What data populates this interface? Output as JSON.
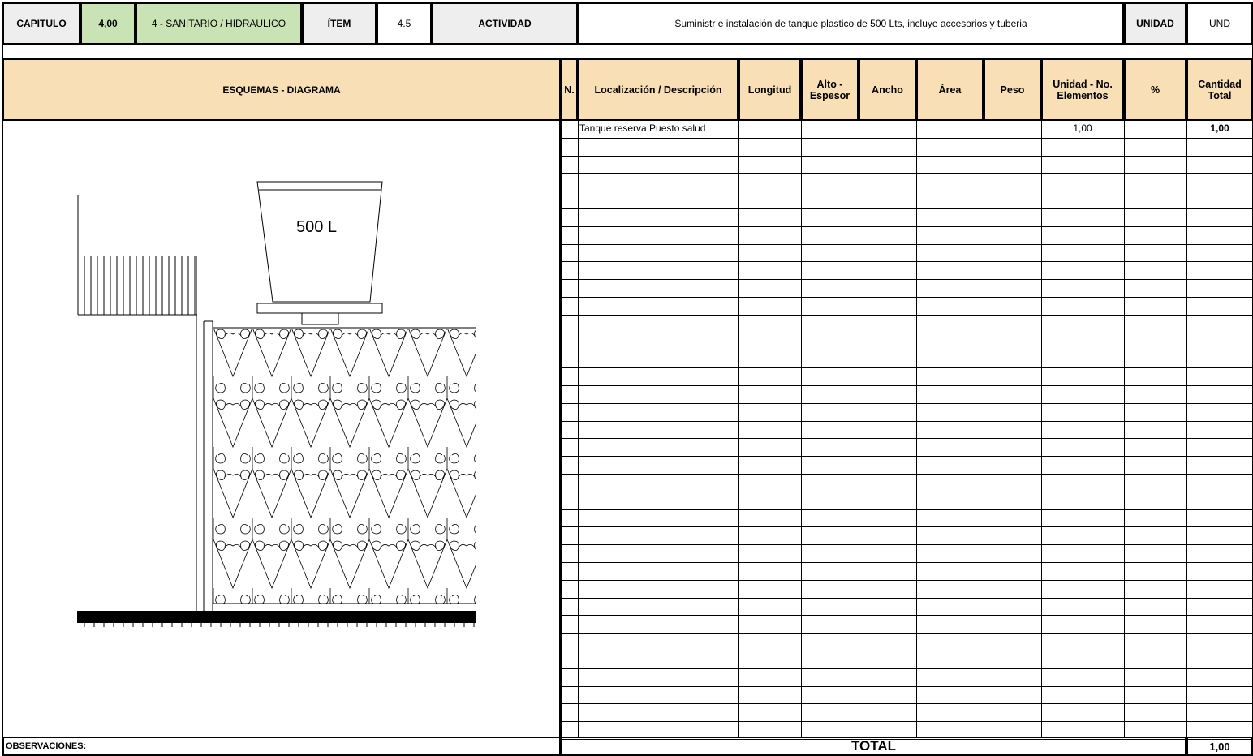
{
  "header": {
    "capitulo_label": "CAPITULO",
    "capitulo_value": "4,00",
    "capitulo_name": "4 - SANITARIO / HIDRAULICO",
    "item_label": "ÍTEM",
    "item_value": "4.5",
    "actividad_label": "ACTIVIDAD",
    "actividad_value": "Suministr e instalación de tanque plastico de 500 Lts, incluye accesorios y tuberia",
    "unidad_label": "UNIDAD",
    "unidad_value": "UND"
  },
  "esquemas_label": "ESQUEMAS - DIAGRAMA",
  "diagram": {
    "tank_label": "500 L"
  },
  "table": {
    "columns": [
      "N.",
      "Localización / Descripción",
      "Longitud",
      "Alto - Espesor",
      "Ancho",
      "Área",
      "Peso",
      "Unidad - No. Elementos",
      "%",
      "Cantidad Total"
    ],
    "rows": [
      {
        "n": "",
        "descripcion": "Tanque reserva Puesto salud",
        "longitud": "",
        "alto": "",
        "ancho": "",
        "area": "",
        "peso": "",
        "unidad": "1,00",
        "porcentaje": "",
        "cantidad": "1,00"
      }
    ]
  },
  "footer": {
    "observaciones_label": "OBSERVACIONES:",
    "total_label": "TOTAL",
    "total_value": "1,00"
  }
}
